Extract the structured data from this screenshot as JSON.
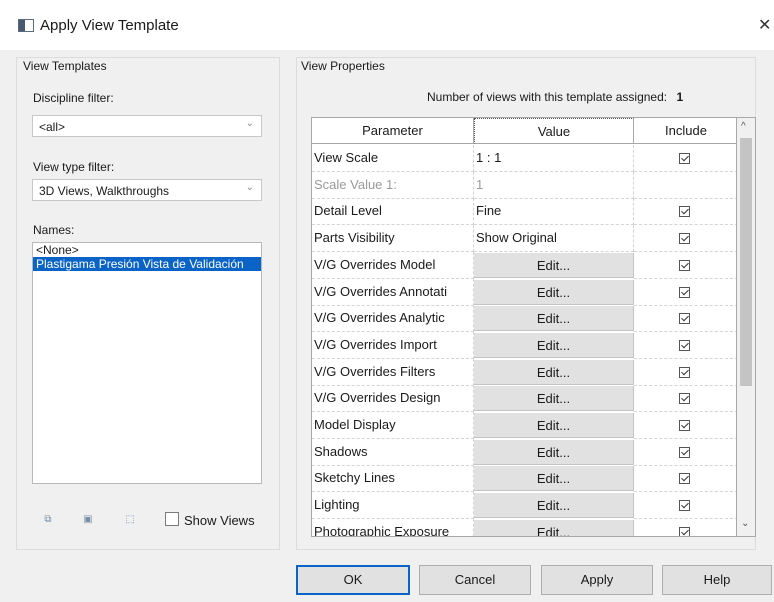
{
  "window": {
    "title": "Apply View Template",
    "close_label": "X"
  },
  "left_panel": {
    "title": "View Templates",
    "discipline_filter": {
      "label": "Discipline filter:",
      "value": "<all>"
    },
    "view_type_filter": {
      "label": "View type filter:",
      "value": "3D Views, Walkthroughs"
    },
    "names": {
      "label": "Names:",
      "items": [
        {
          "text": "<None>",
          "selected": false
        },
        {
          "text": "Plastigama Presión Vista de Validación",
          "selected": true
        }
      ]
    },
    "show_views_label": "Show Views"
  },
  "right_panel": {
    "title": "View Properties",
    "count_label": "Number of views with this template assigned:",
    "count_value": "1",
    "columns": [
      "Parameter",
      "Value",
      "Include"
    ],
    "rows": [
      {
        "param": "View Scale",
        "value": "1 : 1",
        "edit": false,
        "include": true,
        "disabled": false
      },
      {
        "param": "Scale Value    1:",
        "value": "1",
        "edit": false,
        "include": false,
        "disabled": true
      },
      {
        "param": "Detail Level",
        "value": "Fine",
        "edit": false,
        "include": true,
        "disabled": false
      },
      {
        "param": "Parts Visibility",
        "value": "Show Original",
        "edit": false,
        "include": true,
        "disabled": false
      },
      {
        "param": "V/G Overrides Model",
        "value": "Edit...",
        "edit": true,
        "include": true,
        "disabled": false
      },
      {
        "param": "V/G Overrides Annotati",
        "value": "Edit...",
        "edit": true,
        "include": true,
        "disabled": false
      },
      {
        "param": "V/G Overrides Analytic",
        "value": "Edit...",
        "edit": true,
        "include": true,
        "disabled": false
      },
      {
        "param": "V/G Overrides Import",
        "value": "Edit...",
        "edit": true,
        "include": true,
        "disabled": false
      },
      {
        "param": "V/G Overrides Filters",
        "value": "Edit...",
        "edit": true,
        "include": true,
        "disabled": false
      },
      {
        "param": "V/G Overrides Design",
        "value": "Edit...",
        "edit": true,
        "include": true,
        "disabled": false
      },
      {
        "param": "Model Display",
        "value": "Edit...",
        "edit": true,
        "include": true,
        "disabled": false
      },
      {
        "param": "Shadows",
        "value": "Edit...",
        "edit": true,
        "include": true,
        "disabled": false
      },
      {
        "param": "Sketchy Lines",
        "value": "Edit...",
        "edit": true,
        "include": true,
        "disabled": false
      },
      {
        "param": "Lighting",
        "value": "Edit...",
        "edit": true,
        "include": true,
        "disabled": false
      },
      {
        "param": "Photographic Exposure",
        "value": "Edit...",
        "edit": true,
        "include": true,
        "disabled": false
      }
    ]
  },
  "buttons": {
    "ok": "OK",
    "cancel": "Cancel",
    "apply": "Apply",
    "help": "Help"
  }
}
